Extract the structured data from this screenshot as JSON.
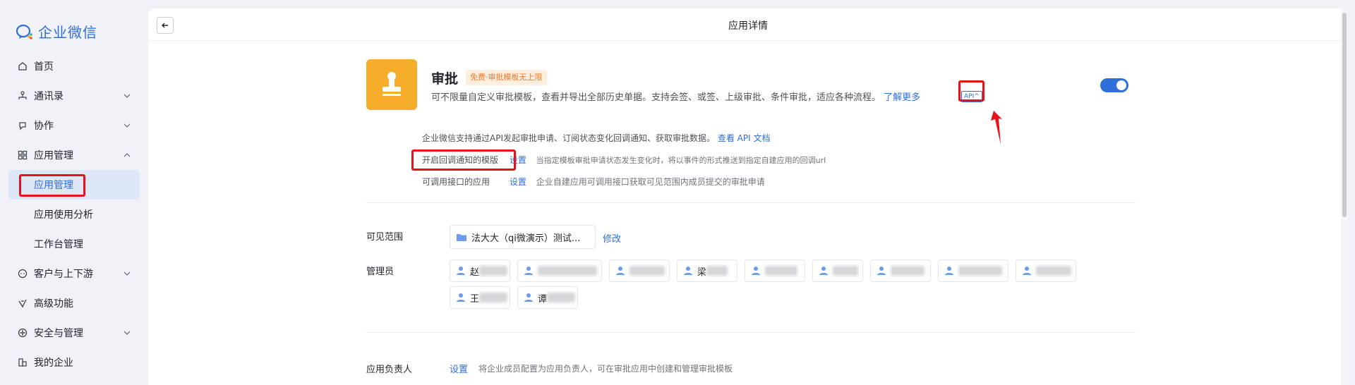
{
  "brand": {
    "name": "企业微信",
    "accent": "#2f6fd8"
  },
  "sidebar": {
    "items": [
      {
        "label": "首页",
        "icon": "home-icon"
      },
      {
        "label": "通讯录",
        "icon": "org-chart-icon",
        "expandable": true
      },
      {
        "label": "协作",
        "icon": "collab-icon",
        "expandable": true
      },
      {
        "label": "应用管理",
        "icon": "grid-icon",
        "expandable": true,
        "expanded": true
      },
      {
        "label": "应用管理",
        "sub": true,
        "active": true
      },
      {
        "label": "应用使用分析",
        "sub": true
      },
      {
        "label": "工作台管理",
        "sub": true
      },
      {
        "label": "客户与上下游",
        "icon": "chat-icon",
        "expandable": true
      },
      {
        "label": "高级功能",
        "icon": "star-icon"
      },
      {
        "label": "安全与管理",
        "icon": "shield-icon",
        "expandable": true
      },
      {
        "label": "我的企业",
        "icon": "building-icon"
      }
    ]
  },
  "header": {
    "title": "应用详情"
  },
  "app": {
    "name": "审批",
    "badge": "免费·审批模板无上限",
    "description": "可不限量自定义审批模板，查看并导出全部历史单据。支持会签、或签、上级审批、条件审批，适应各种流程。",
    "learn_more": "了解更多",
    "api_tag": "API^",
    "enabled": true
  },
  "api_section": {
    "intro": "企业微信支持通过API发起审批申请、订阅状态变化回调通知、获取审批数据。",
    "doc_link": "查看 API 文档",
    "callback_label": "开启回调通知的模版",
    "callback_action": "设置",
    "callback_hint": "当指定模板审批申请状态发生变化时，将以事件的形式推送到指定自建应用的回调url",
    "callable_label": "可调用接口的应用",
    "callable_action": "设置",
    "callable_hint": "企业自建应用可调用接口获取可见范围内成员提交的审批申请"
  },
  "visibility": {
    "label": "可见范围",
    "scope": "法大大（qi微演示）测试...",
    "modify": "修改"
  },
  "admins": {
    "label": "管理员",
    "members": [
      "赵",
      "",
      "",
      "梁",
      "",
      "",
      "",
      "",
      "",
      "王",
      "谭"
    ]
  },
  "owner": {
    "label": "应用负责人",
    "action": "设置",
    "hint": "将企业成员配置为应用负责人，可在审批应用中创建和管理审批模板"
  }
}
